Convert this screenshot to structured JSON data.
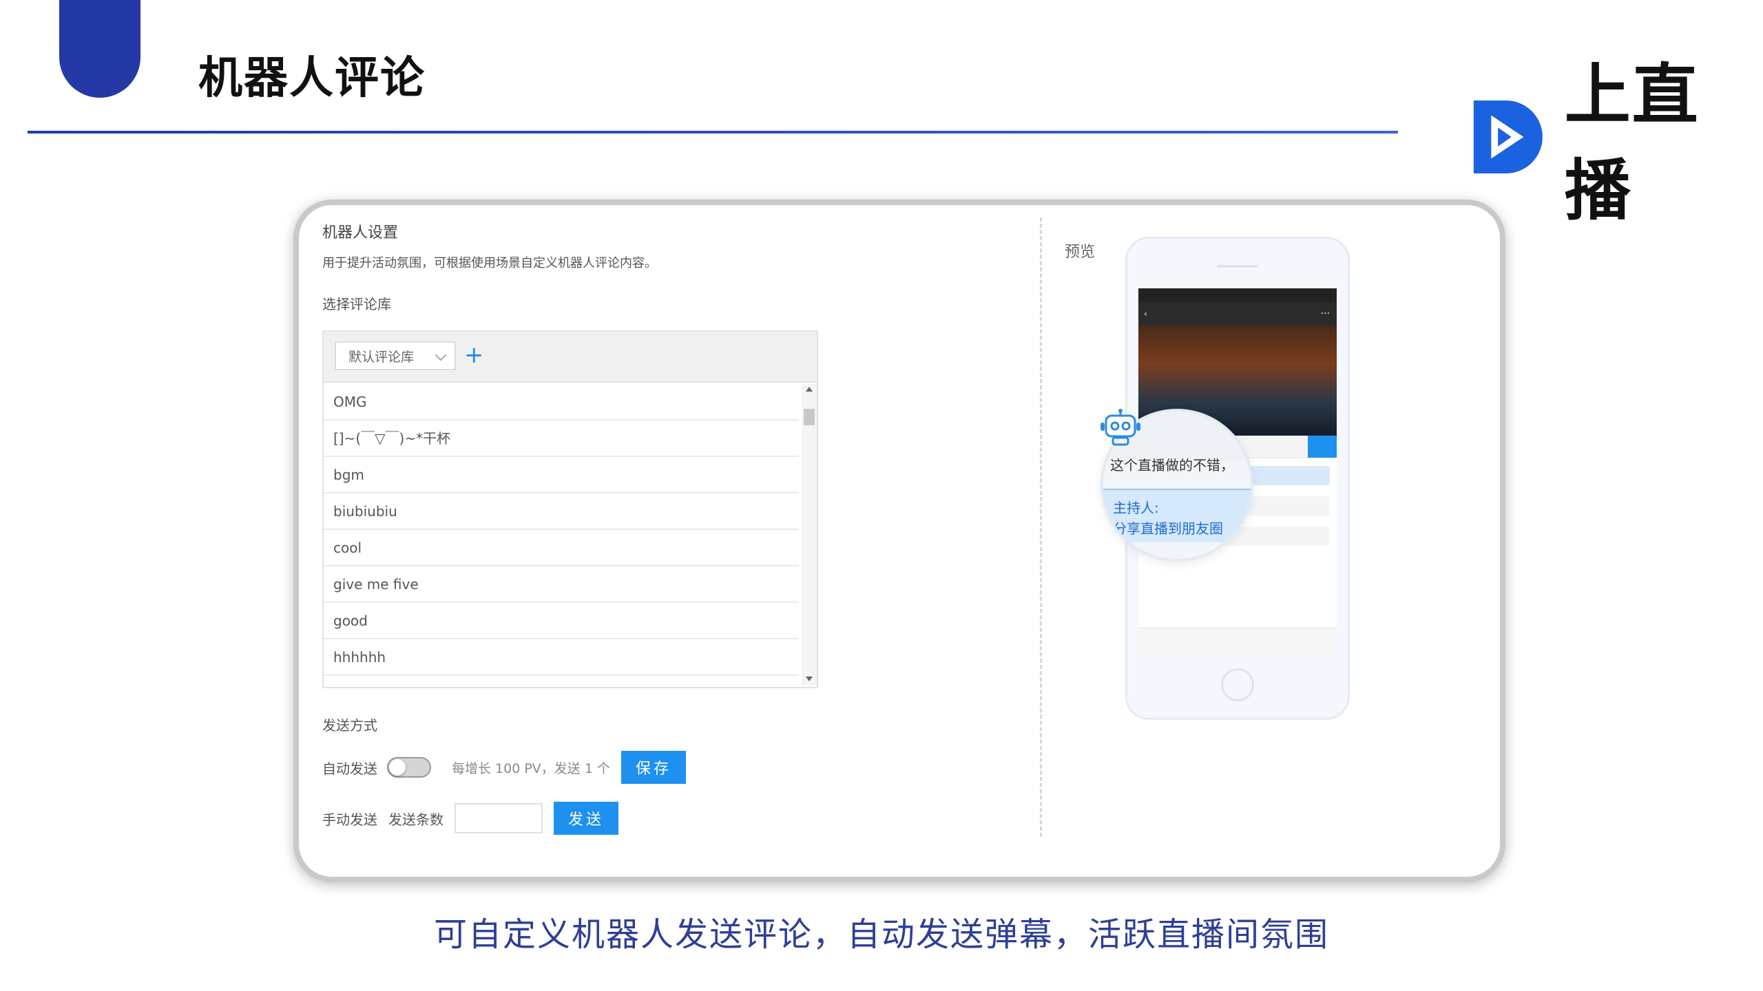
{
  "slide": {
    "title": "机器人评论",
    "logo_text": "上直播",
    "caption": "可自定义机器人发送评论，自动发送弹幕，活跃直播间氛围"
  },
  "robot_settings": {
    "title": "机器人设置",
    "description": "用于提升活动氛围，可根据使用场景自定义机器人评论内容。",
    "select_library_label": "选择评论库",
    "library_selected": "默认评论库",
    "add_label": "+",
    "comments": [
      "OMG",
      "[]~(￣▽￣)~*干杯",
      "bgm",
      "biubiubiu",
      "cool",
      "give me five",
      "good",
      "hhhhhh"
    ],
    "send_mode_label": "发送方式",
    "auto_send_label": "自动发送",
    "auto_send_on": false,
    "auto_send_hint": "每增长 100 PV，发送 1 个",
    "save_label": "保存",
    "manual_send_label": "手动发送",
    "send_count_label": "发送条数",
    "send_count_value": "",
    "send_label": "发送"
  },
  "preview": {
    "label": "预览",
    "sample_comment": "这个直播做的不错，",
    "host_label": "主持人:",
    "host_message": "分享直播到朋友圈"
  },
  "colors": {
    "accent_blue": "#2539a6",
    "button_blue": "#1e90f0",
    "caption_blue": "#2e3f96"
  }
}
